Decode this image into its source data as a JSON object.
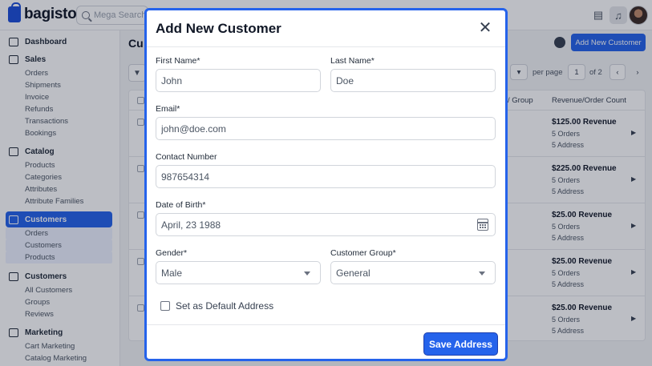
{
  "app": {
    "name": "bagisto"
  },
  "search": {
    "placeholder": "Mega Search"
  },
  "sidebar": {
    "dashboard": "Dashboard",
    "sales": {
      "label": "Sales",
      "items": [
        "Orders",
        "Shipments",
        "Invoice",
        "Refunds",
        "Transactions",
        "Bookings"
      ]
    },
    "catalog": {
      "label": "Catalog",
      "items": [
        "Products",
        "Categories",
        "Attributes",
        "Attribute Families"
      ]
    },
    "customers_active": {
      "label": "Customers",
      "items": [
        "Orders",
        "Customers",
        "Products"
      ]
    },
    "customers": {
      "label": "Customers",
      "items": [
        "All Customers",
        "Groups",
        "Reviews"
      ]
    },
    "marketing": {
      "label": "Marketing",
      "items": [
        "Cart Marketing",
        "Catalog Marketing"
      ]
    }
  },
  "page": {
    "title": "Cu",
    "add_button": "Add New Customer",
    "per_page": "per page",
    "page_num": "1",
    "page_total": "of 2",
    "col_group": "/ Group",
    "col_revenue": "Revenue/Order Count",
    "rows": [
      {
        "revenue": "$125.00 Revenue",
        "orders": "5 Orders",
        "address": "5 Address"
      },
      {
        "revenue": "$225.00 Revenue",
        "orders": "5 Orders",
        "address": "5 Address"
      },
      {
        "revenue": "$25.00 Revenue",
        "orders": "5 Orders",
        "address": "5 Address"
      },
      {
        "revenue": "$25.00 Revenue",
        "orders": "5 Orders",
        "address": "5 Address"
      },
      {
        "revenue": "$25.00 Revenue",
        "orders": "5 Orders",
        "address": "5 Address"
      }
    ]
  },
  "modal": {
    "title": "Add New Customer",
    "first_name": {
      "label": "First Name*",
      "value": "John"
    },
    "last_name": {
      "label": "Last Name*",
      "value": "Doe"
    },
    "email": {
      "label": "Email*",
      "value": "john@doe.com"
    },
    "contact": {
      "label": "Contact Number",
      "value": "987654314"
    },
    "dob": {
      "label": "Date of Birth*",
      "value": "April, 23 1988"
    },
    "gender": {
      "label": "Gender*",
      "value": "Male"
    },
    "group": {
      "label": "Customer Group*",
      "value": "General"
    },
    "default_address": "Set as Default Address",
    "save": "Save Address"
  },
  "colors": {
    "accent": "#2563eb"
  }
}
